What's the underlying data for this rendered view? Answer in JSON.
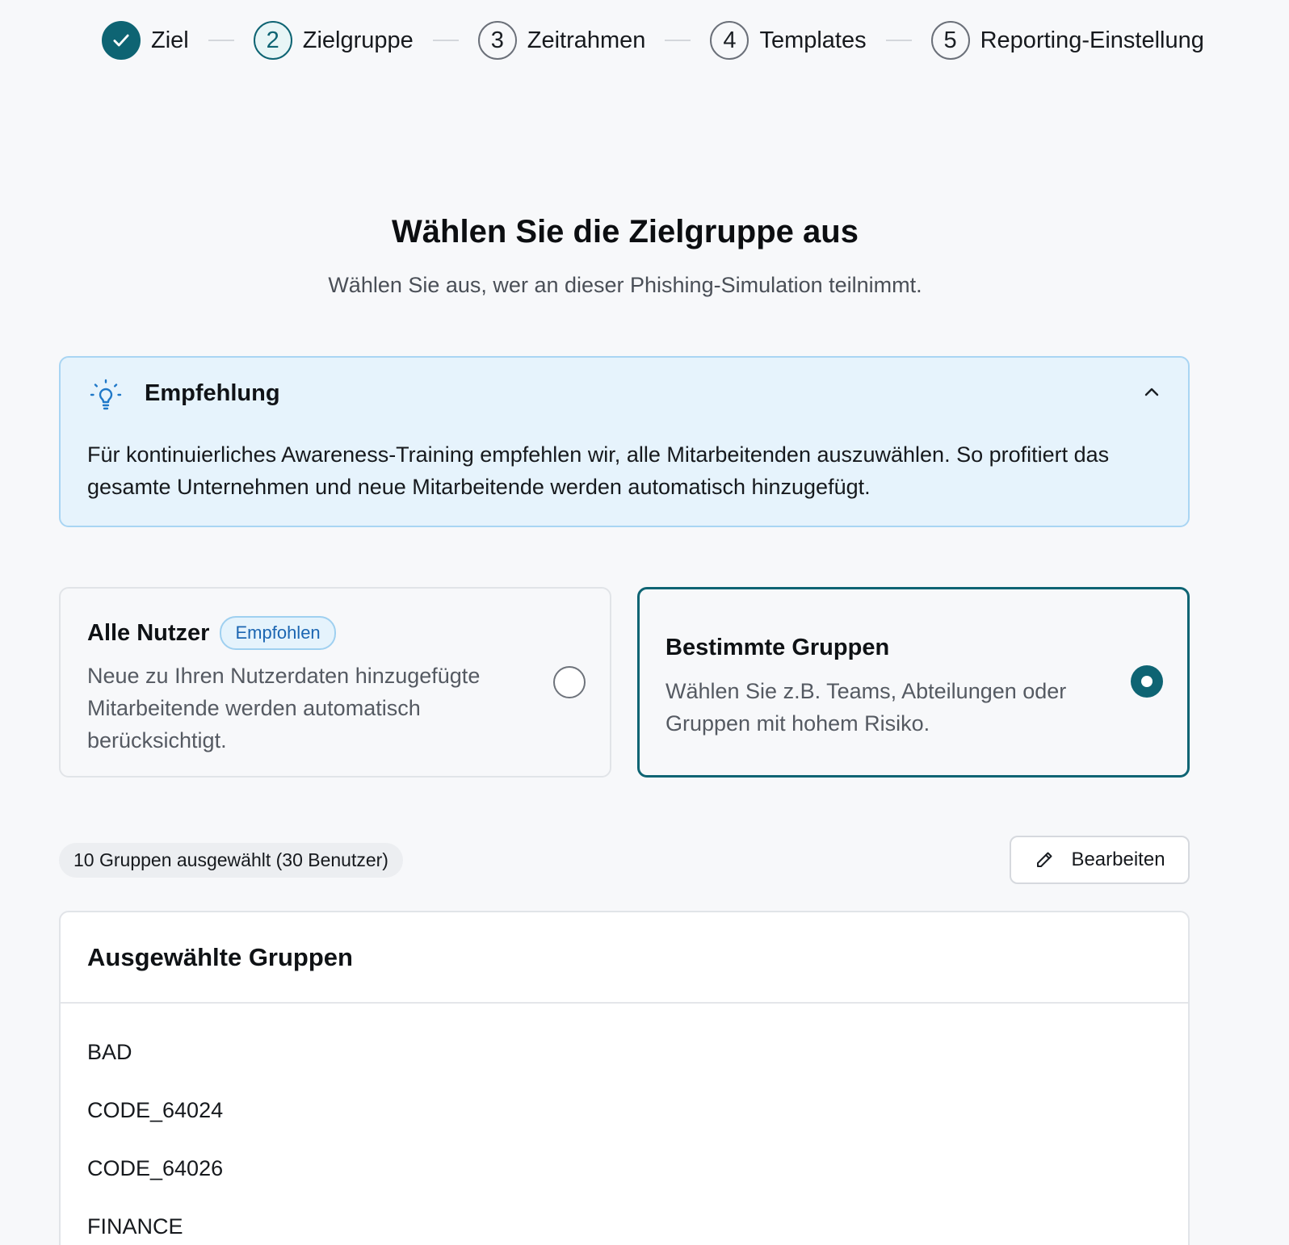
{
  "stepper": {
    "steps": [
      {
        "number": "",
        "label": "Ziel",
        "state": "done"
      },
      {
        "number": "2",
        "label": "Zielgruppe",
        "state": "active"
      },
      {
        "number": "3",
        "label": "Zeitrahmen",
        "state": "pending"
      },
      {
        "number": "4",
        "label": "Templates",
        "state": "pending"
      },
      {
        "number": "5",
        "label": "Reporting-Einstellung",
        "state": "pending"
      }
    ]
  },
  "heading": {
    "title": "Wählen Sie die Zielgruppe aus",
    "subtitle": "Wählen Sie aus, wer an dieser Phishing-Simulation teilnimmt."
  },
  "recommendation": {
    "icon": "lightbulb-icon",
    "title": "Empfehlung",
    "text": "Für kontinuierliches Awareness-Training empfehlen wir, alle Mitarbeitenden auszuwählen. So profitiert das gesamte Unternehmen und neue Mitarbeitende werden automatisch hinzugefügt.",
    "expanded": true
  },
  "options": {
    "all_users": {
      "title": "Alle Nutzer",
      "badge": "Empfohlen",
      "description": "Neue zu Ihren Nutzerdaten hinzugefügte Mitarbeitende werden automatisch berücksichtigt.",
      "selected": false
    },
    "specific_groups": {
      "title": "Bestimmte Gruppen",
      "description": "Wählen Sie z.B. Teams, Abteilungen oder Gruppen mit hohem Risiko.",
      "selected": true
    }
  },
  "selection": {
    "summary": "10 Gruppen ausgewählt (30 Benutzer)",
    "edit_label": "Bearbeiten"
  },
  "groups_panel": {
    "title": "Ausgewählte Gruppen",
    "items": [
      "BAD",
      "CODE_64024",
      "CODE_64026",
      "FINANCE"
    ]
  },
  "colors": {
    "accent": "#0e6473",
    "info_bg": "#e6f3fc",
    "info_border": "#a9d5f3",
    "badge_text": "#1c66b2"
  }
}
